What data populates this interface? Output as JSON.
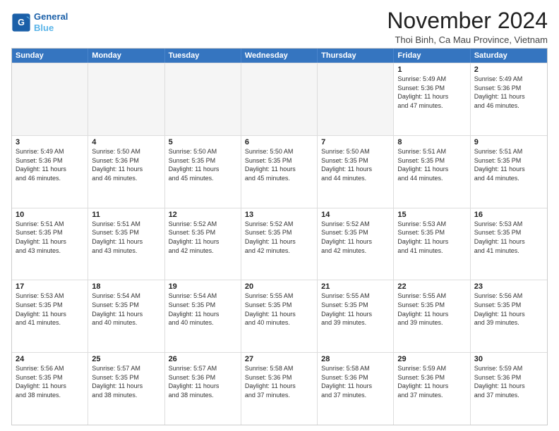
{
  "logo": {
    "line1": "General",
    "line2": "Blue"
  },
  "header": {
    "month": "November 2024",
    "location": "Thoi Binh, Ca Mau Province, Vietnam"
  },
  "weekdays": [
    "Sunday",
    "Monday",
    "Tuesday",
    "Wednesday",
    "Thursday",
    "Friday",
    "Saturday"
  ],
  "rows": [
    [
      {
        "day": "",
        "info": "",
        "empty": true
      },
      {
        "day": "",
        "info": "",
        "empty": true
      },
      {
        "day": "",
        "info": "",
        "empty": true
      },
      {
        "day": "",
        "info": "",
        "empty": true
      },
      {
        "day": "",
        "info": "",
        "empty": true
      },
      {
        "day": "1",
        "info": "Sunrise: 5:49 AM\nSunset: 5:36 PM\nDaylight: 11 hours\nand 47 minutes.",
        "empty": false
      },
      {
        "day": "2",
        "info": "Sunrise: 5:49 AM\nSunset: 5:36 PM\nDaylight: 11 hours\nand 46 minutes.",
        "empty": false
      }
    ],
    [
      {
        "day": "3",
        "info": "Sunrise: 5:49 AM\nSunset: 5:36 PM\nDaylight: 11 hours\nand 46 minutes.",
        "empty": false
      },
      {
        "day": "4",
        "info": "Sunrise: 5:50 AM\nSunset: 5:36 PM\nDaylight: 11 hours\nand 46 minutes.",
        "empty": false
      },
      {
        "day": "5",
        "info": "Sunrise: 5:50 AM\nSunset: 5:35 PM\nDaylight: 11 hours\nand 45 minutes.",
        "empty": false
      },
      {
        "day": "6",
        "info": "Sunrise: 5:50 AM\nSunset: 5:35 PM\nDaylight: 11 hours\nand 45 minutes.",
        "empty": false
      },
      {
        "day": "7",
        "info": "Sunrise: 5:50 AM\nSunset: 5:35 PM\nDaylight: 11 hours\nand 44 minutes.",
        "empty": false
      },
      {
        "day": "8",
        "info": "Sunrise: 5:51 AM\nSunset: 5:35 PM\nDaylight: 11 hours\nand 44 minutes.",
        "empty": false
      },
      {
        "day": "9",
        "info": "Sunrise: 5:51 AM\nSunset: 5:35 PM\nDaylight: 11 hours\nand 44 minutes.",
        "empty": false
      }
    ],
    [
      {
        "day": "10",
        "info": "Sunrise: 5:51 AM\nSunset: 5:35 PM\nDaylight: 11 hours\nand 43 minutes.",
        "empty": false
      },
      {
        "day": "11",
        "info": "Sunrise: 5:51 AM\nSunset: 5:35 PM\nDaylight: 11 hours\nand 43 minutes.",
        "empty": false
      },
      {
        "day": "12",
        "info": "Sunrise: 5:52 AM\nSunset: 5:35 PM\nDaylight: 11 hours\nand 42 minutes.",
        "empty": false
      },
      {
        "day": "13",
        "info": "Sunrise: 5:52 AM\nSunset: 5:35 PM\nDaylight: 11 hours\nand 42 minutes.",
        "empty": false
      },
      {
        "day": "14",
        "info": "Sunrise: 5:52 AM\nSunset: 5:35 PM\nDaylight: 11 hours\nand 42 minutes.",
        "empty": false
      },
      {
        "day": "15",
        "info": "Sunrise: 5:53 AM\nSunset: 5:35 PM\nDaylight: 11 hours\nand 41 minutes.",
        "empty": false
      },
      {
        "day": "16",
        "info": "Sunrise: 5:53 AM\nSunset: 5:35 PM\nDaylight: 11 hours\nand 41 minutes.",
        "empty": false
      }
    ],
    [
      {
        "day": "17",
        "info": "Sunrise: 5:53 AM\nSunset: 5:35 PM\nDaylight: 11 hours\nand 41 minutes.",
        "empty": false
      },
      {
        "day": "18",
        "info": "Sunrise: 5:54 AM\nSunset: 5:35 PM\nDaylight: 11 hours\nand 40 minutes.",
        "empty": false
      },
      {
        "day": "19",
        "info": "Sunrise: 5:54 AM\nSunset: 5:35 PM\nDaylight: 11 hours\nand 40 minutes.",
        "empty": false
      },
      {
        "day": "20",
        "info": "Sunrise: 5:55 AM\nSunset: 5:35 PM\nDaylight: 11 hours\nand 40 minutes.",
        "empty": false
      },
      {
        "day": "21",
        "info": "Sunrise: 5:55 AM\nSunset: 5:35 PM\nDaylight: 11 hours\nand 39 minutes.",
        "empty": false
      },
      {
        "day": "22",
        "info": "Sunrise: 5:55 AM\nSunset: 5:35 PM\nDaylight: 11 hours\nand 39 minutes.",
        "empty": false
      },
      {
        "day": "23",
        "info": "Sunrise: 5:56 AM\nSunset: 5:35 PM\nDaylight: 11 hours\nand 39 minutes.",
        "empty": false
      }
    ],
    [
      {
        "day": "24",
        "info": "Sunrise: 5:56 AM\nSunset: 5:35 PM\nDaylight: 11 hours\nand 38 minutes.",
        "empty": false
      },
      {
        "day": "25",
        "info": "Sunrise: 5:57 AM\nSunset: 5:35 PM\nDaylight: 11 hours\nand 38 minutes.",
        "empty": false
      },
      {
        "day": "26",
        "info": "Sunrise: 5:57 AM\nSunset: 5:36 PM\nDaylight: 11 hours\nand 38 minutes.",
        "empty": false
      },
      {
        "day": "27",
        "info": "Sunrise: 5:58 AM\nSunset: 5:36 PM\nDaylight: 11 hours\nand 37 minutes.",
        "empty": false
      },
      {
        "day": "28",
        "info": "Sunrise: 5:58 AM\nSunset: 5:36 PM\nDaylight: 11 hours\nand 37 minutes.",
        "empty": false
      },
      {
        "day": "29",
        "info": "Sunrise: 5:59 AM\nSunset: 5:36 PM\nDaylight: 11 hours\nand 37 minutes.",
        "empty": false
      },
      {
        "day": "30",
        "info": "Sunrise: 5:59 AM\nSunset: 5:36 PM\nDaylight: 11 hours\nand 37 minutes.",
        "empty": false
      }
    ]
  ]
}
